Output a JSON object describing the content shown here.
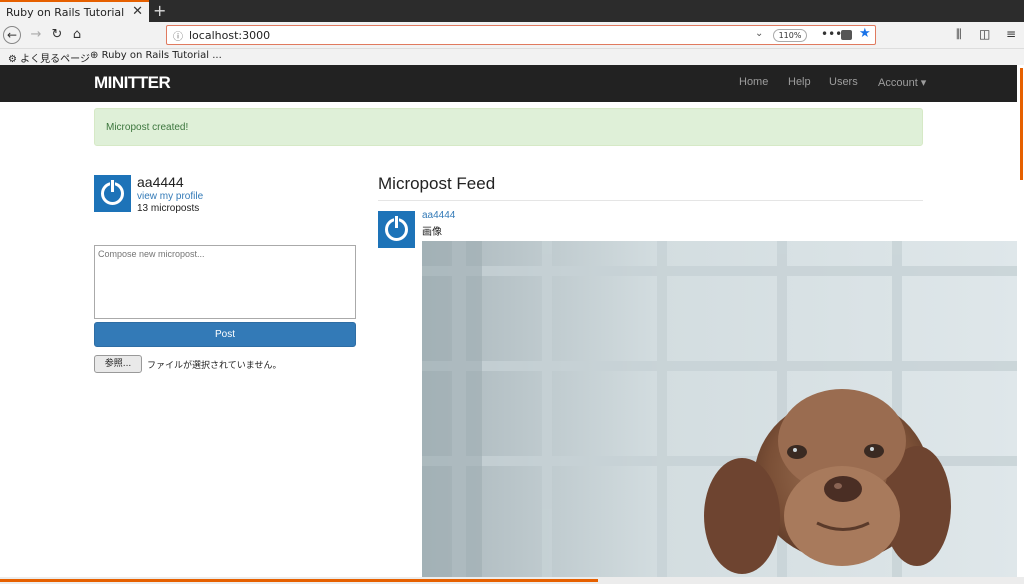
{
  "browser": {
    "tab_title": "Ruby on Rails Tutorial Samp",
    "tab_close": "✕",
    "new_tab": "+",
    "url": "localhost:3000",
    "zoom": "110%",
    "bookmarks": [
      {
        "label": "よく見るページ"
      },
      {
        "label": "Ruby on Rails Tutorial ..."
      }
    ]
  },
  "header": {
    "logo": "MINITTER",
    "menu": [
      {
        "label": "Home"
      },
      {
        "label": "Help"
      },
      {
        "label": "Users"
      },
      {
        "label": "Account ▾"
      }
    ]
  },
  "flash": "Micropost created!",
  "user_info": {
    "name": "aa4444",
    "profile_link": "view my profile",
    "micropost_count": "13 microposts"
  },
  "micropost_form": {
    "placeholder": "Compose new micropost...",
    "post_button": "Post",
    "browse_button": "参照...",
    "file_status": "ファイルが選択されていません。"
  },
  "feed": {
    "title": "Micropost Feed",
    "items": [
      {
        "user": "aa4444",
        "content": "画像"
      }
    ]
  },
  "colors": {
    "navbar": "#222222",
    "accent": "#337ab7",
    "alert_bg": "#dff0d8",
    "alert_text": "#3c763d",
    "gravatar": "#1d73b8",
    "firefox_orange": "#e66000"
  }
}
